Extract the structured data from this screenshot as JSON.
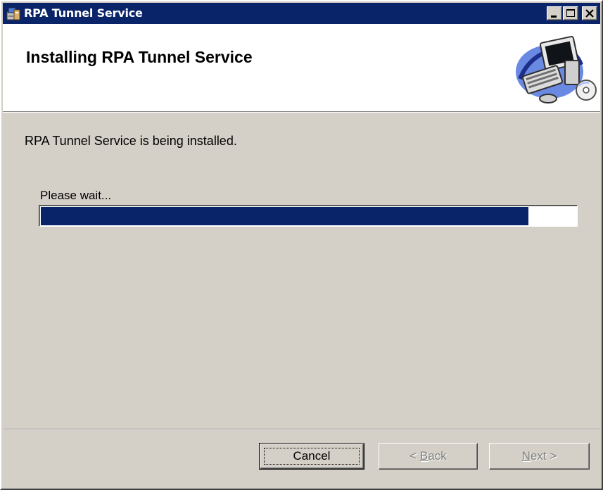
{
  "window": {
    "title": "RPA Tunnel Service",
    "icon": "installer-icon",
    "controls": [
      "minimize-icon",
      "maximize-icon",
      "close-icon"
    ]
  },
  "banner": {
    "title": "Installing RPA Tunnel Service",
    "graphic": "computer-setup-graphic"
  },
  "body": {
    "status_text": "RPA Tunnel Service is being installed.",
    "wait_text": "Please wait..."
  },
  "progress": {
    "value_percent": 91
  },
  "buttons": {
    "cancel": {
      "label": "Cancel",
      "enabled": true,
      "focused": true
    },
    "back": {
      "arrow": "<",
      "accel": "B",
      "rest": "ack",
      "enabled": false
    },
    "next": {
      "accel": "N",
      "rest": "ext",
      "arrow": ">",
      "enabled": false
    }
  },
  "colors": {
    "titlebar": "#0a246a",
    "progress_fill": "#0a246a",
    "face": "#d4d0c8",
    "disabled_text": "#808080"
  }
}
